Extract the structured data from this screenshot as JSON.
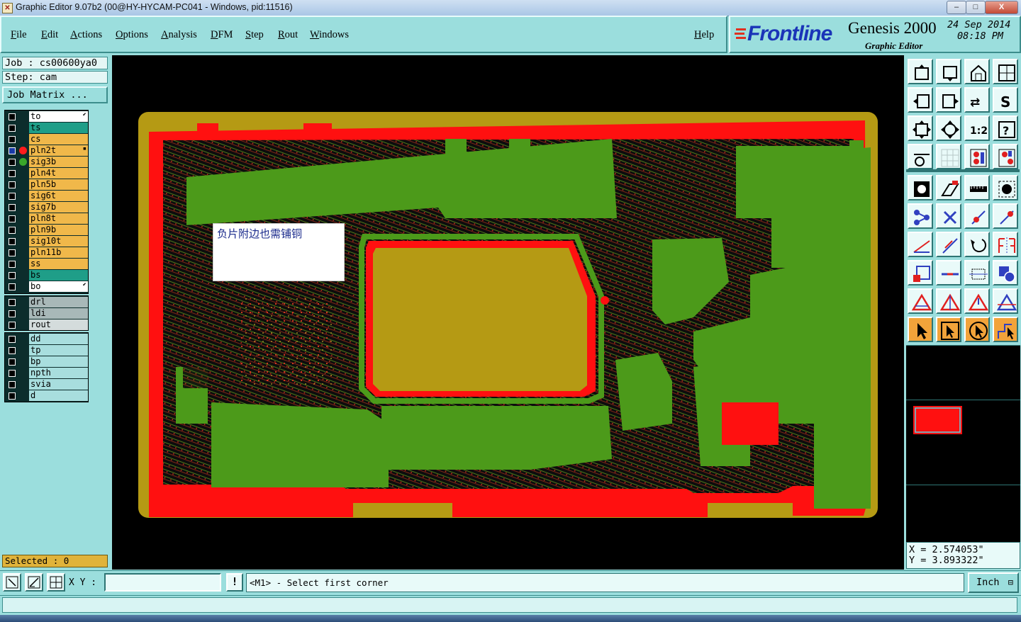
{
  "window": {
    "title": "Graphic Editor 9.07b2 (00@HY-HYCAM-PC041 - Windows, pid:11516)",
    "min_label": "–",
    "max_label": "□",
    "close_label": "X"
  },
  "menu": {
    "items": [
      "File",
      "Edit",
      "Actions",
      "Options",
      "Analysis",
      "DFM",
      "Step",
      "Rout",
      "Windows"
    ],
    "help": "Help"
  },
  "logo": {
    "brand": "Frontline",
    "product": "Genesis 2000",
    "subtitle": "Graphic Editor",
    "date": "24 Sep 2014",
    "time": "08:18 PM"
  },
  "job": {
    "job_line": "Job : cs00600ya0",
    "step_line": "Step: cam",
    "matrix_button": "Job Matrix ..."
  },
  "layers": {
    "group1": [
      {
        "name": "to",
        "color": "#ffffff",
        "dot": "",
        "selected": false,
        "arrow": "⬋"
      },
      {
        "name": "ts",
        "color": "#1f9e88",
        "dot": "",
        "selected": false,
        "arrow": ""
      },
      {
        "name": "cs",
        "color": "#f0b84a",
        "dot": "",
        "selected": false,
        "arrow": ""
      },
      {
        "name": "pln2t",
        "color": "#f0b84a",
        "dot": "#ff1c1c",
        "selected": true,
        "arrow": "▪"
      },
      {
        "name": "sig3b",
        "color": "#f0b84a",
        "dot": "#3aa62a",
        "selected": false,
        "arrow": ""
      },
      {
        "name": "pln4t",
        "color": "#f0b84a",
        "dot": "",
        "selected": false,
        "arrow": ""
      },
      {
        "name": "pln5b",
        "color": "#f0b84a",
        "dot": "",
        "selected": false,
        "arrow": ""
      },
      {
        "name": "sig6t",
        "color": "#f0b84a",
        "dot": "",
        "selected": false,
        "arrow": ""
      },
      {
        "name": "sig7b",
        "color": "#f0b84a",
        "dot": "",
        "selected": false,
        "arrow": ""
      },
      {
        "name": "pln8t",
        "color": "#f0b84a",
        "dot": "",
        "selected": false,
        "arrow": ""
      },
      {
        "name": "pln9b",
        "color": "#f0b84a",
        "dot": "",
        "selected": false,
        "arrow": ""
      },
      {
        "name": "sig10t",
        "color": "#f0b84a",
        "dot": "",
        "selected": false,
        "arrow": ""
      },
      {
        "name": "pln11b",
        "color": "#f0b84a",
        "dot": "",
        "selected": false,
        "arrow": ""
      },
      {
        "name": "ss",
        "color": "#f0b84a",
        "dot": "",
        "selected": false,
        "arrow": ""
      },
      {
        "name": "bs",
        "color": "#1f9e88",
        "dot": "",
        "selected": false,
        "arrow": ""
      },
      {
        "name": "bo",
        "color": "#ffffff",
        "dot": "",
        "selected": false,
        "arrow": "⬋"
      }
    ],
    "group2": [
      {
        "name": "drl",
        "color": "#a8b8b8",
        "dot": "",
        "selected": false,
        "arrow": ""
      },
      {
        "name": "ldi",
        "color": "#a8b8b8",
        "dot": "",
        "selected": false,
        "arrow": ""
      },
      {
        "name": "rout",
        "color": "#d4dcdc",
        "dot": "",
        "selected": false,
        "arrow": ""
      }
    ],
    "group3": [
      {
        "name": "dd",
        "color": "#a8dede",
        "dot": "",
        "selected": false,
        "arrow": ""
      },
      {
        "name": "tp",
        "color": "#a8dede",
        "dot": "",
        "selected": false,
        "arrow": ""
      },
      {
        "name": "bp",
        "color": "#a8dede",
        "dot": "",
        "selected": false,
        "arrow": ""
      },
      {
        "name": "npth",
        "color": "#a8dede",
        "dot": "",
        "selected": false,
        "arrow": ""
      },
      {
        "name": "svia",
        "color": "#a8dede",
        "dot": "",
        "selected": false,
        "arrow": ""
      },
      {
        "name": "d",
        "color": "#a8dede",
        "dot": "",
        "selected": false,
        "arrow": ""
      }
    ]
  },
  "selected": "Selected : 0",
  "canvas": {
    "note": "负片附边也需铺铜"
  },
  "toolbar": {
    "icons": [
      "home-zoom-icon",
      "fit-zoom-icon",
      "house-icon",
      "window-icon",
      "pan-left-icon",
      "pan-right-icon",
      "swap-icon",
      "redraw-icon",
      "zoom-fit-icon",
      "zoom-center-icon",
      "scale-1-2-icon",
      "help-icon",
      "snap-icon",
      "grid-icon",
      "layer-red-icon",
      "layer-red2-icon",
      "pad-icon",
      "edit-shape-icon",
      "ruler-icon",
      "circle-pad-icon",
      "connect-icon",
      "cross-icon",
      "line-dot-icon",
      "line-dot2-icon",
      "angle-icon",
      "diagonal-icon",
      "arc-icon",
      "mirror-icon",
      "move-small-icon",
      "minus-icon",
      "resize-icon",
      "square-circle-icon",
      "triangle-red-icon",
      "triangle-red2-icon",
      "triangle-red3-icon",
      "triangle-blue-icon",
      "pointer-icon",
      "pointer-box-icon",
      "pointer-circle-icon",
      "pointer-route-icon"
    ]
  },
  "coords": {
    "x": "X = 2.574053\"",
    "y": "Y = 3.893322\""
  },
  "bottom": {
    "xy_label": "X Y :",
    "xy_value": "",
    "message": "<M1> - Select first corner",
    "unit": "Inch",
    "exclaim": "!"
  }
}
